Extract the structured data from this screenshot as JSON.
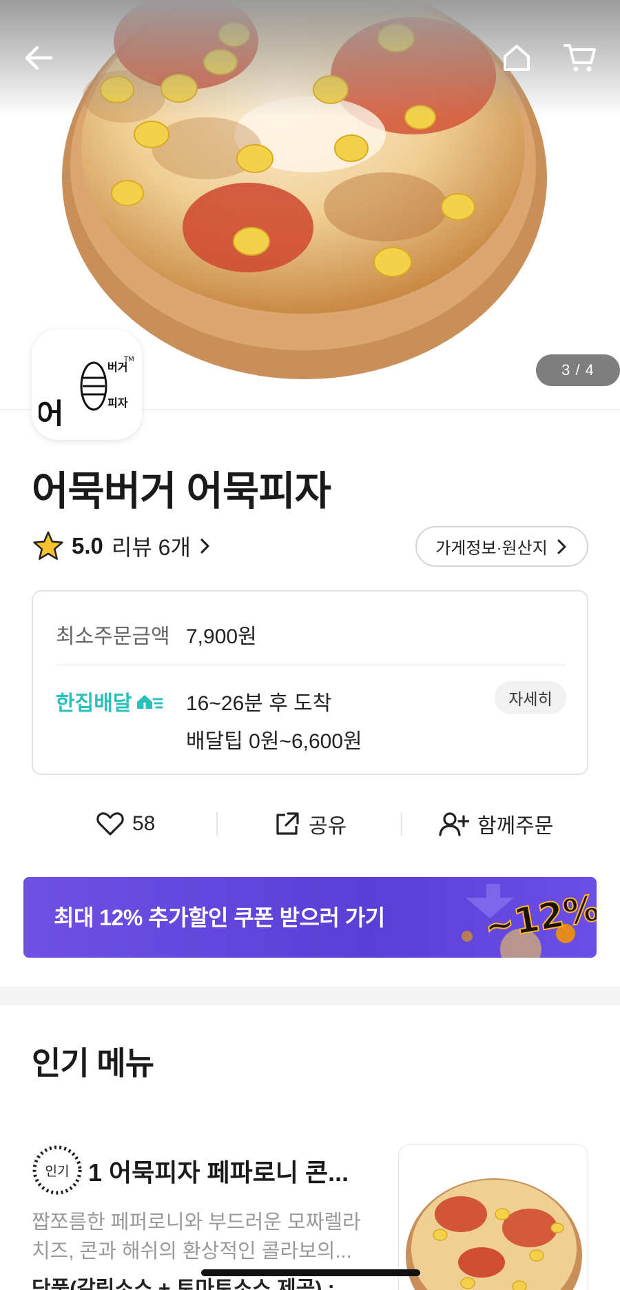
{
  "hero": {
    "image_counter": "3 / 4",
    "icons": {
      "back": "arrow-left-icon",
      "home": "home-icon",
      "cart": "cart-icon"
    }
  },
  "store": {
    "logo_text": {
      "line1": "어묵",
      "line2": "버거",
      "line3": "피자",
      "tm": "TM"
    },
    "name": "어묵버거 어묵피자",
    "rating": "5.0",
    "review_label": "리뷰 6개",
    "info_button": "가게정보·원산지"
  },
  "delivery": {
    "min_order_label": "최소주문금액",
    "min_order_value": "7,900원",
    "service_label": "한집배달",
    "time": "16~26분 후 도착",
    "tip": "배달팁 0원~6,600원",
    "detail_button": "자세히",
    "accent_color": "#2ac1bc"
  },
  "actions": {
    "like_count": "58",
    "share_label": "공유",
    "group_order_label": "함께주문"
  },
  "coupon": {
    "text": "최대 12% 추가할인 쿠폰 받으러 가기",
    "graphic_text": "~12%",
    "color": "#6e50e6"
  },
  "popular": {
    "title": "인기 메뉴",
    "items": [
      {
        "badge": "인기",
        "name": "1 어묵피자 페파로니 콘...",
        "description_line1": "짭쪼름한 페퍼로니와 부드러운 모짜렐라",
        "description_line2": "치즈, 콘과 해쉬의 환상적인 콜라보의...",
        "price_line": "단품(갈릭소스 + 토마토소스 제공) :"
      }
    ]
  }
}
